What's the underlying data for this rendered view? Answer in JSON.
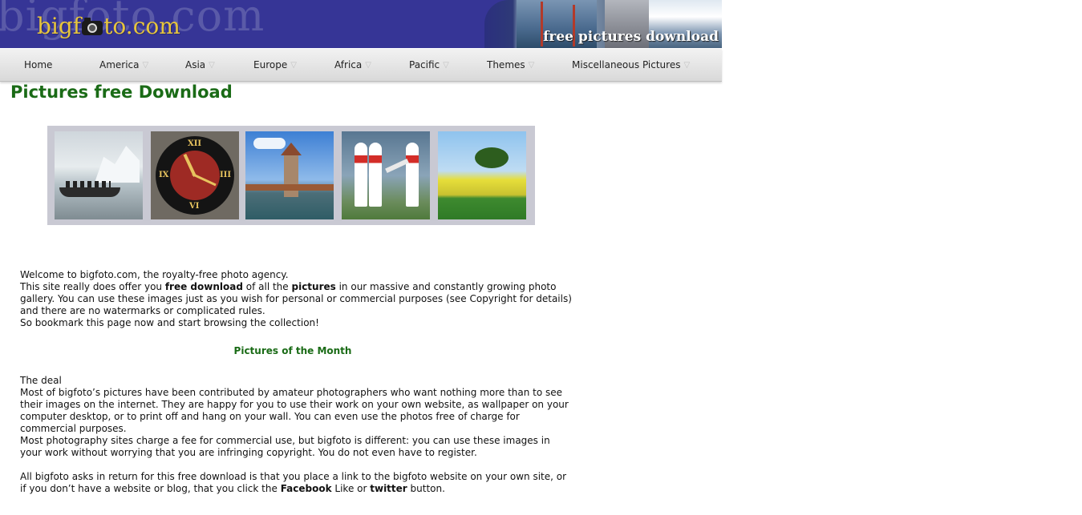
{
  "header": {
    "bg_word": "bigfoto.com",
    "logo_prefix": "bigf",
    "logo_suffix": "to.com",
    "strip_caption": "free pictures download"
  },
  "nav": {
    "items": [
      {
        "label": "Home",
        "has_dropdown": false
      },
      {
        "label": "America",
        "has_dropdown": true
      },
      {
        "label": "Asia",
        "has_dropdown": true
      },
      {
        "label": "Europe",
        "has_dropdown": true
      },
      {
        "label": "Africa",
        "has_dropdown": true
      },
      {
        "label": "Pacific",
        "has_dropdown": true
      },
      {
        "label": "Themes",
        "has_dropdown": true
      },
      {
        "label": "Miscellaneous Pictures",
        "has_dropdown": true
      }
    ],
    "arrow_glyph": "▽"
  },
  "page": {
    "title": "Pictures free Download"
  },
  "gallery": {
    "thumbnails": [
      {
        "subject": "iceberg-boat"
      },
      {
        "subject": "clock"
      },
      {
        "subject": "tower-bridge"
      },
      {
        "subject": "air-race-pylons"
      },
      {
        "subject": "tree-field"
      }
    ],
    "clock_numerals": [
      "XII",
      "III",
      "VI",
      "IX"
    ]
  },
  "intro": {
    "line1": "Welcome to bigfoto.com, the royalty-free photo agency.",
    "line2_a": "This site really does offer you ",
    "line2_b1": "free download",
    "line2_c": " of all the ",
    "line2_b2": "pictures",
    "line2_d": " in our massive and constantly growing photo gallery. You can use these images just as you wish for personal or commercial purposes (see Copyright for details) and there are no watermarks or complicated rules.",
    "line3": "So bookmark this page now and start browsing the collection!"
  },
  "month": {
    "title": "Pictures of the Month"
  },
  "deal": {
    "heading": "The deal",
    "para1": "Most of bigfoto’s pictures have been contributed by amateur photographers who want nothing more than to see their images on the internet. They are happy for you to use their work on your own website, as wallpaper on your computer desktop, or to print off and hang on your wall. You can even use the photos free of charge for commercial purposes.",
    "para2": "Most photography sites charge a fee for commercial use, but bigfoto is different: you can use these images in your work without worrying that you are infringing copyright. You do not even have to register."
  },
  "asks": {
    "text_a": "All bigfoto asks in return for this free download is that you place a link to the bigfoto website on your own site, or if you don’t have a website or blog, that you click the ",
    "facebook": "Facebook",
    "text_b": " Like or ",
    "twitter": "twitter",
    "text_c": " button."
  },
  "colors": {
    "banner": "#363596",
    "logo": "#e7c53c",
    "title_green": "#1a6b16",
    "gallery_frame": "#c9c9d3"
  }
}
